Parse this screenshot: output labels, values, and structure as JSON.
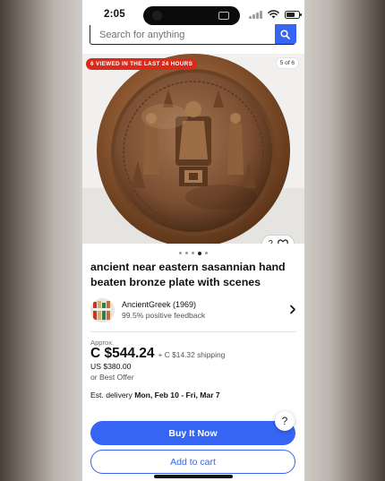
{
  "status_bar": {
    "time": "2:05"
  },
  "search": {
    "placeholder": "Search for anything"
  },
  "gallery": {
    "viewed_badge": "6 VIEWED IN THE LAST 24 HOURS",
    "image_counter": "5 of 6",
    "watch_count": "2",
    "total_dots": 5,
    "active_dot": 4
  },
  "listing": {
    "title": "ancient near eastern sasannian hand beaten bronze plate with scenes"
  },
  "seller": {
    "name": "AncientGreek (1969)",
    "feedback": "99.5% positive feedback"
  },
  "price": {
    "approx_label": "Approx.",
    "amount": "C $544.24",
    "shipping": "+ C $14.32 shipping",
    "original": "US $380.00",
    "offer": "or Best Offer"
  },
  "delivery": {
    "label": "Est. delivery",
    "dates": "Mon, Feb 10 - Fri, Mar 7"
  },
  "actions": {
    "help": "?",
    "buy_now": "Buy It Now",
    "add_to_cart": "Add to cart"
  },
  "colors": {
    "accent_blue": "#3665f3",
    "badge_red": "#d92b1c",
    "bronze": "#8a5a32"
  }
}
